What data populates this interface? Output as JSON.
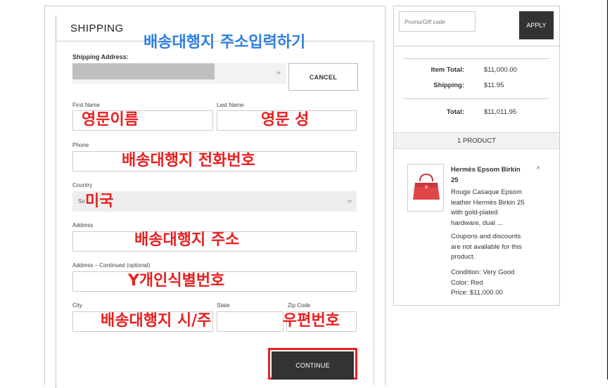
{
  "shipping": {
    "title": "SHIPPING",
    "overlay_title": "배송대행지 주소입력하기",
    "address_label": "Shipping Address:",
    "cancel_label": "CANCEL",
    "first_name_label": "First Name",
    "last_name_label": "Last Name",
    "phone_label": "Phone",
    "country_label": "Country",
    "country_value": "So",
    "address_label2": "Address",
    "address2_label": "Address – Continued (optional)",
    "city_label": "City",
    "state_label": "State",
    "zip_label": "Zip Code",
    "continue_label": "CONTINUE"
  },
  "overlays": {
    "first_name": "영문이름",
    "last_name": "영문 성",
    "phone": "배송대행지 전화번호",
    "country": "미국",
    "address": "배송대행지 주소",
    "address2": "Y개인식별번호",
    "city_state": "배송대행지 시/주",
    "zip": "우편번호"
  },
  "summary": {
    "promo_placeholder": "Promo/Gift code",
    "apply_label": "APPLY",
    "item_total_label": "Item Total:",
    "item_total_value": "$11,000.00",
    "shipping_label": "Shipping:",
    "shipping_value": "$11.95",
    "total_label": "Total:",
    "total_value": "$11,011.95",
    "product_count": "1 PRODUCT"
  },
  "product": {
    "name_line1": "Hermès Epsom Birkin",
    "name_line2": "25",
    "close": "×",
    "desc": [
      "Rouge Casaque Epsom",
      "leather Hermès Birkin 25",
      "with gold-plated",
      "hardware, dual ..."
    ],
    "coupon": [
      "Coupons and discounts",
      "are not available for this",
      "product."
    ],
    "condition": "Condition: Very Good",
    "color": "Color: Red",
    "price": "Price: $11,000.00"
  },
  "colors": {
    "overlay_red": "#e8201f",
    "overlay_blue": "#2f7fe0",
    "button_dark": "#333333"
  }
}
